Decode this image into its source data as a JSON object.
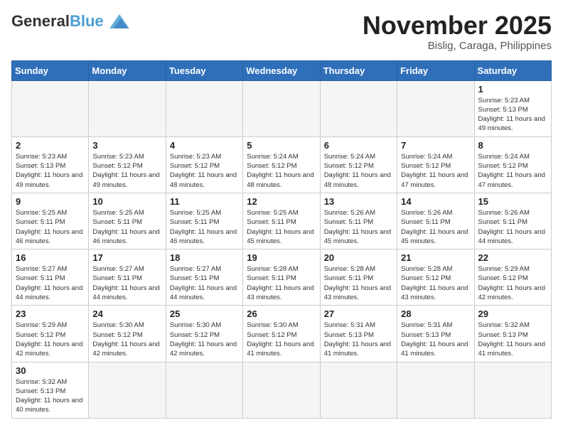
{
  "header": {
    "logo_general": "General",
    "logo_blue": "Blue",
    "month_title": "November 2025",
    "location": "Bislig, Caraga, Philippines"
  },
  "weekdays": [
    "Sunday",
    "Monday",
    "Tuesday",
    "Wednesday",
    "Thursday",
    "Friday",
    "Saturday"
  ],
  "weeks": [
    [
      {
        "day": "",
        "info": ""
      },
      {
        "day": "",
        "info": ""
      },
      {
        "day": "",
        "info": ""
      },
      {
        "day": "",
        "info": ""
      },
      {
        "day": "",
        "info": ""
      },
      {
        "day": "",
        "info": ""
      },
      {
        "day": "1",
        "info": "Sunrise: 5:23 AM\nSunset: 5:13 PM\nDaylight: 11 hours and 49 minutes."
      }
    ],
    [
      {
        "day": "2",
        "info": "Sunrise: 5:23 AM\nSunset: 5:13 PM\nDaylight: 11 hours and 49 minutes."
      },
      {
        "day": "3",
        "info": "Sunrise: 5:23 AM\nSunset: 5:12 PM\nDaylight: 11 hours and 49 minutes."
      },
      {
        "day": "4",
        "info": "Sunrise: 5:23 AM\nSunset: 5:12 PM\nDaylight: 11 hours and 48 minutes."
      },
      {
        "day": "5",
        "info": "Sunrise: 5:24 AM\nSunset: 5:12 PM\nDaylight: 11 hours and 48 minutes."
      },
      {
        "day": "6",
        "info": "Sunrise: 5:24 AM\nSunset: 5:12 PM\nDaylight: 11 hours and 48 minutes."
      },
      {
        "day": "7",
        "info": "Sunrise: 5:24 AM\nSunset: 5:12 PM\nDaylight: 11 hours and 47 minutes."
      },
      {
        "day": "8",
        "info": "Sunrise: 5:24 AM\nSunset: 5:12 PM\nDaylight: 11 hours and 47 minutes."
      }
    ],
    [
      {
        "day": "9",
        "info": "Sunrise: 5:25 AM\nSunset: 5:11 PM\nDaylight: 11 hours and 46 minutes."
      },
      {
        "day": "10",
        "info": "Sunrise: 5:25 AM\nSunset: 5:11 PM\nDaylight: 11 hours and 46 minutes."
      },
      {
        "day": "11",
        "info": "Sunrise: 5:25 AM\nSunset: 5:11 PM\nDaylight: 11 hours and 46 minutes."
      },
      {
        "day": "12",
        "info": "Sunrise: 5:25 AM\nSunset: 5:11 PM\nDaylight: 11 hours and 45 minutes."
      },
      {
        "day": "13",
        "info": "Sunrise: 5:26 AM\nSunset: 5:11 PM\nDaylight: 11 hours and 45 minutes."
      },
      {
        "day": "14",
        "info": "Sunrise: 5:26 AM\nSunset: 5:11 PM\nDaylight: 11 hours and 45 minutes."
      },
      {
        "day": "15",
        "info": "Sunrise: 5:26 AM\nSunset: 5:11 PM\nDaylight: 11 hours and 44 minutes."
      }
    ],
    [
      {
        "day": "16",
        "info": "Sunrise: 5:27 AM\nSunset: 5:11 PM\nDaylight: 11 hours and 44 minutes."
      },
      {
        "day": "17",
        "info": "Sunrise: 5:27 AM\nSunset: 5:11 PM\nDaylight: 11 hours and 44 minutes."
      },
      {
        "day": "18",
        "info": "Sunrise: 5:27 AM\nSunset: 5:11 PM\nDaylight: 11 hours and 44 minutes."
      },
      {
        "day": "19",
        "info": "Sunrise: 5:28 AM\nSunset: 5:11 PM\nDaylight: 11 hours and 43 minutes."
      },
      {
        "day": "20",
        "info": "Sunrise: 5:28 AM\nSunset: 5:11 PM\nDaylight: 11 hours and 43 minutes."
      },
      {
        "day": "21",
        "info": "Sunrise: 5:28 AM\nSunset: 5:12 PM\nDaylight: 11 hours and 43 minutes."
      },
      {
        "day": "22",
        "info": "Sunrise: 5:29 AM\nSunset: 5:12 PM\nDaylight: 11 hours and 42 minutes."
      }
    ],
    [
      {
        "day": "23",
        "info": "Sunrise: 5:29 AM\nSunset: 5:12 PM\nDaylight: 11 hours and 42 minutes."
      },
      {
        "day": "24",
        "info": "Sunrise: 5:30 AM\nSunset: 5:12 PM\nDaylight: 11 hours and 42 minutes."
      },
      {
        "day": "25",
        "info": "Sunrise: 5:30 AM\nSunset: 5:12 PM\nDaylight: 11 hours and 42 minutes."
      },
      {
        "day": "26",
        "info": "Sunrise: 5:30 AM\nSunset: 5:12 PM\nDaylight: 11 hours and 41 minutes."
      },
      {
        "day": "27",
        "info": "Sunrise: 5:31 AM\nSunset: 5:13 PM\nDaylight: 11 hours and 41 minutes."
      },
      {
        "day": "28",
        "info": "Sunrise: 5:31 AM\nSunset: 5:13 PM\nDaylight: 11 hours and 41 minutes."
      },
      {
        "day": "29",
        "info": "Sunrise: 5:32 AM\nSunset: 5:13 PM\nDaylight: 11 hours and 41 minutes."
      }
    ],
    [
      {
        "day": "30",
        "info": "Sunrise: 5:32 AM\nSunset: 5:13 PM\nDaylight: 11 hours and 40 minutes."
      },
      {
        "day": "",
        "info": ""
      },
      {
        "day": "",
        "info": ""
      },
      {
        "day": "",
        "info": ""
      },
      {
        "day": "",
        "info": ""
      },
      {
        "day": "",
        "info": ""
      },
      {
        "day": "",
        "info": ""
      }
    ]
  ]
}
